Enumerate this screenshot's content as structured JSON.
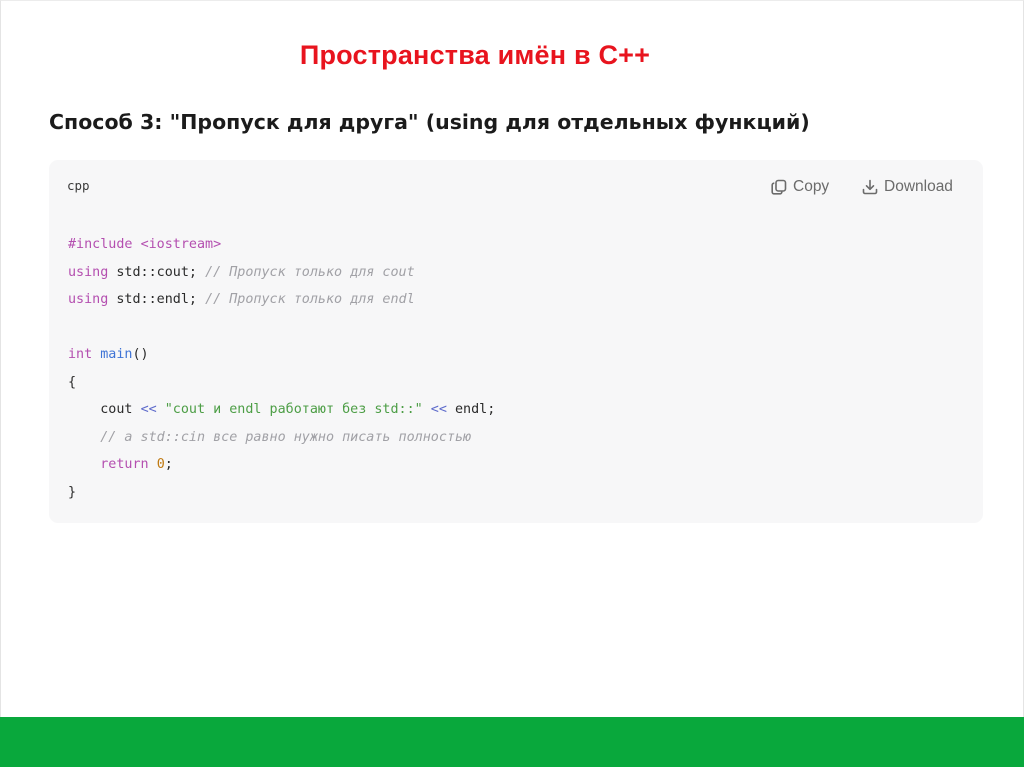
{
  "slide": {
    "title": "Пространства имён в C++",
    "heading": "Способ 3: \"Пропуск для друга\" (using для отдельных функций)",
    "footer_color": "#09a83c",
    "title_color": "#e8141e"
  },
  "code_block": {
    "language": "cpp",
    "copy_label": "Copy",
    "download_label": "Download",
    "copy_icon": "copy-icon",
    "download_icon": "download-icon",
    "lines": [
      [
        {
          "t": "#include ",
          "c": "kw"
        },
        {
          "t": "<iostream>",
          "c": "kw"
        }
      ],
      [
        {
          "t": "using",
          "c": "kw"
        },
        {
          "t": " std::cout; ",
          "c": "id"
        },
        {
          "t": "// Пропуск только для cout",
          "c": "cm"
        }
      ],
      [
        {
          "t": "using",
          "c": "kw"
        },
        {
          "t": " std::endl; ",
          "c": "id"
        },
        {
          "t": "// Пропуск только для endl",
          "c": "cm"
        }
      ],
      [],
      [
        {
          "t": "int",
          "c": "type"
        },
        {
          "t": " ",
          "c": "id"
        },
        {
          "t": "main",
          "c": "fn"
        },
        {
          "t": "()",
          "c": "punct"
        }
      ],
      [
        {
          "t": "{",
          "c": "punct"
        }
      ],
      [
        {
          "t": "    cout ",
          "c": "id"
        },
        {
          "t": "<<",
          "c": "op"
        },
        {
          "t": " ",
          "c": "id"
        },
        {
          "t": "\"cout и endl работают без std::\"",
          "c": "str"
        },
        {
          "t": " ",
          "c": "id"
        },
        {
          "t": "<<",
          "c": "op"
        },
        {
          "t": " endl;",
          "c": "id"
        }
      ],
      [
        {
          "t": "    ",
          "c": "id"
        },
        {
          "t": "// а std::cin все равно нужно писать полностью",
          "c": "cm"
        }
      ],
      [
        {
          "t": "    ",
          "c": "id"
        },
        {
          "t": "return",
          "c": "kw"
        },
        {
          "t": " ",
          "c": "id"
        },
        {
          "t": "0",
          "c": "num"
        },
        {
          "t": ";",
          "c": "punct"
        }
      ],
      [
        {
          "t": "}",
          "c": "punct"
        }
      ]
    ]
  }
}
